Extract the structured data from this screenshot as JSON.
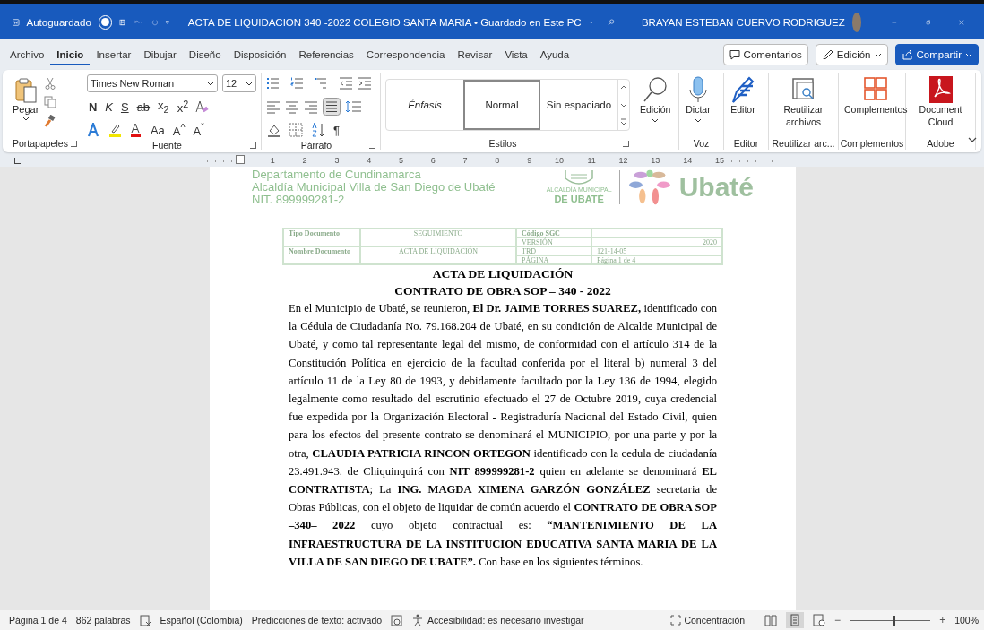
{
  "title_bar": {
    "autosave_label": "Autoguardado",
    "autosave_on": false,
    "title": "ACTA DE LIQUIDACION  340 -2022 COLEGIO SANTA MARIA • Guardado en Este PC",
    "user": "BRAYAN ESTEBAN CUERVO RODRIGUEZ"
  },
  "menu_tabs": [
    {
      "label": "Archivo",
      "selected": false
    },
    {
      "label": "Inicio",
      "selected": true
    },
    {
      "label": "Insertar",
      "selected": false
    },
    {
      "label": "Dibujar",
      "selected": false
    },
    {
      "label": "Diseño",
      "selected": false
    },
    {
      "label": "Disposición",
      "selected": false
    },
    {
      "label": "Referencias",
      "selected": false
    },
    {
      "label": "Correspondencia",
      "selected": false
    },
    {
      "label": "Revisar",
      "selected": false
    },
    {
      "label": "Vista",
      "selected": false
    },
    {
      "label": "Ayuda",
      "selected": false
    }
  ],
  "actions": {
    "comments": "Comentarios",
    "editing": "Edición",
    "share": "Compartir"
  },
  "ribbon": {
    "paste": "Pegar",
    "font_name": "Times New Roman",
    "font_size": "12",
    "format_buttons": [
      {
        "kind": "bold",
        "label": "N"
      },
      {
        "kind": "italic",
        "label": "K"
      },
      {
        "kind": "underline",
        "label": "S"
      },
      {
        "kind": "strike",
        "label": "ab"
      },
      {
        "kind": "plain",
        "label": "x$_{2}$"
      },
      {
        "kind": "plain",
        "label": "x$^{2}$"
      }
    ],
    "font_buttons": [
      {
        "label": "Aa"
      },
      {
        "label": "A$^{^}$"
      },
      {
        "label": "A$^{ˇ}$"
      }
    ],
    "pilcrow": "¶",
    "styles": [
      {
        "label": "Énfasis",
        "selected": false
      },
      {
        "label": "Normal",
        "selected": true
      },
      {
        "label": "Sin espaciado",
        "selected": false
      }
    ],
    "large_buttons": [
      {
        "kind": "search",
        "label": "Edición",
        "dropdown": true
      },
      {
        "kind": "mic",
        "label": "Dictar",
        "group": "Voz",
        "dropdown": true
      },
      {
        "kind": "pen",
        "label": "Editor",
        "group": "Editor",
        "dropdown": false
      },
      {
        "kind": "reuse",
        "label": "Reutilizar archivos",
        "group": "Reutilizar arc...",
        "dropdown": false
      },
      {
        "kind": "addins",
        "label": "Complementos",
        "group": "Complementos",
        "dropdown": false
      },
      {
        "kind": "pdf",
        "label": "Document Cloud",
        "group": "Adobe",
        "dropdown": false
      }
    ],
    "group_labels": [
      "Portapapeles",
      "Fuente",
      "Párrafo",
      "Estilos"
    ]
  },
  "ruler_marks": [
    "1",
    "2",
    "3",
    "4",
    "5",
    "6",
    "7",
    "8",
    "9",
    "10",
    "11",
    "12",
    "13",
    "14",
    "15"
  ],
  "letterhead": {
    "lines": [
      "Departamento de Cundinamarca",
      "Alcaldía Municipal Villa de San Diego de Ubaté",
      "NIT. 899999281-2"
    ],
    "seal_caption": "ALCALDÍA MUNICIPAL",
    "seal_name": "DE UBATÉ",
    "logo_text": "Ubaté"
  },
  "doc_table": {
    "left": [
      {
        "label": "Tipo Documento",
        "value": "SEGUIMIENTO"
      },
      {
        "label": "Nombre Documento",
        "value": "ACTA DE LIQUIDACIÓN"
      }
    ],
    "right": [
      {
        "label": "Código SGC"
      },
      {
        "label": "VERSIÓN",
        "value": "2020"
      },
      {
        "label": "TRD",
        "value": "121-14-05"
      },
      {
        "label": "PÁGINA",
        "value": "Página 1 de 4"
      }
    ]
  },
  "headings": [
    "ACTA DE LIQUIDACIÓN",
    "CONTRATO DE OBRA SOP – 340 - 2022"
  ],
  "body": "En el Municipio de Ubaté, se reunieron, **El Dr. JAIME TORRES SUAREZ,** identificado con la Cédula de Ciudadanía No. 79.168.204 de Ubaté, en su condición de Alcalde Municipal de Ubaté, y como tal representante legal del mismo, de conformidad con el artículo 314 de la Constitución Política en ejercicio de la facultad conferida por el literal b) numeral 3 del artículo 11 de la Ley 80 de 1993, y debidamente facultado por la Ley 136 de 1994, elegido legalmente como resultado del escrutinio efectuado el 27 de Octubre 2019, cuya credencial fue expedida por la Organización Electoral - Registraduría Nacional del Estado Civil, quien para los efectos del presente contrato se denominará el MUNICIPIO, por una parte y por la otra, **CLAUDIA PATRICIA RINCON ORTEGON** identificado con la cedula de ciudadanía 23.491.943. de Chiquinquirá con **NIT 899999281-2** quien en adelante se denominará **EL CONTRATISTA**; La **ING. MAGDA XIMENA GARZÓN GONZÁLEZ** secretaria de Obras Públicas, con el objeto de liquidar de común acuerdo el **CONTRATO DE OBRA SOP –340– 2022** cuyo objeto contractual es: **“MANTENIMIENTO DE LA INFRAESTRUCTURA DE LA INSTITUCION EDUCATIVA SANTA MARIA DE LA VILLA DE SAN DIEGO DE UBATE”.**  Con base en los siguientes términos.",
  "status_bar": {
    "page": "Página 1 de 4",
    "words": "862 palabras",
    "language": "Español (Colombia)",
    "predictions": "Predicciones de texto: activado",
    "accessibility": "Accesibilidad: es necesario investigar",
    "focus": "Concentración",
    "zoom_out": "−",
    "zoom_slider": {
      "level": 0.55
    },
    "zoom_in": "+",
    "zoom": "100%"
  }
}
